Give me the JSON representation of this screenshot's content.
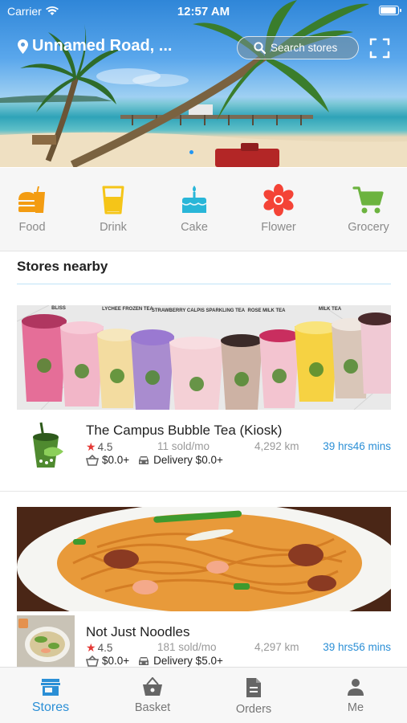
{
  "status_bar": {
    "carrier": "Carrier",
    "time": "12:57 AM"
  },
  "header": {
    "location": "Unnamed Road, ...",
    "search_placeholder": "Search stores"
  },
  "categories": [
    {
      "label": "Food",
      "icon": "burger-icon",
      "color": "#f39c12"
    },
    {
      "label": "Drink",
      "icon": "drink-cup-icon",
      "color": "#f5c518"
    },
    {
      "label": "Cake",
      "icon": "cake-icon",
      "color": "#29b6d8"
    },
    {
      "label": "Flower",
      "icon": "flower-icon",
      "color": "#f44336"
    },
    {
      "label": "Grocery",
      "icon": "cart-icon",
      "color": "#6cb33f"
    }
  ],
  "nearby": {
    "title": "Stores nearby",
    "stores": [
      {
        "name": "The Campus Bubble Tea (Kiosk)",
        "rating": "4.5",
        "sold": "11 sold/mo",
        "distance": "4,292 km",
        "eta": "39 hrs46 mins",
        "min_order": "$0.0+",
        "delivery": "Delivery $0.0+",
        "image_labels": [
          "BLISS",
          "LYCHEE FROZEN TEA",
          "STRAWBERRY CALPIS SPARKLING TEA",
          "ROSE MILK TEA",
          "MILK TEA"
        ]
      },
      {
        "name": "Not Just Noodles",
        "rating": "4.5",
        "sold": "181 sold/mo",
        "distance": "4,297 km",
        "eta": "39 hrs56 mins",
        "min_order": "$0.0+",
        "delivery": "Delivery $5.0+"
      }
    ]
  },
  "tabs": [
    {
      "label": "Stores",
      "icon": "store-icon",
      "active": true
    },
    {
      "label": "Basket",
      "icon": "basket-icon",
      "active": false
    },
    {
      "label": "Orders",
      "icon": "orders-icon",
      "active": false
    },
    {
      "label": "Me",
      "icon": "person-icon",
      "active": false
    }
  ],
  "colors": {
    "accent": "#2b8fd6",
    "rating_star": "#e53935",
    "eta": "#2b8fd6"
  }
}
